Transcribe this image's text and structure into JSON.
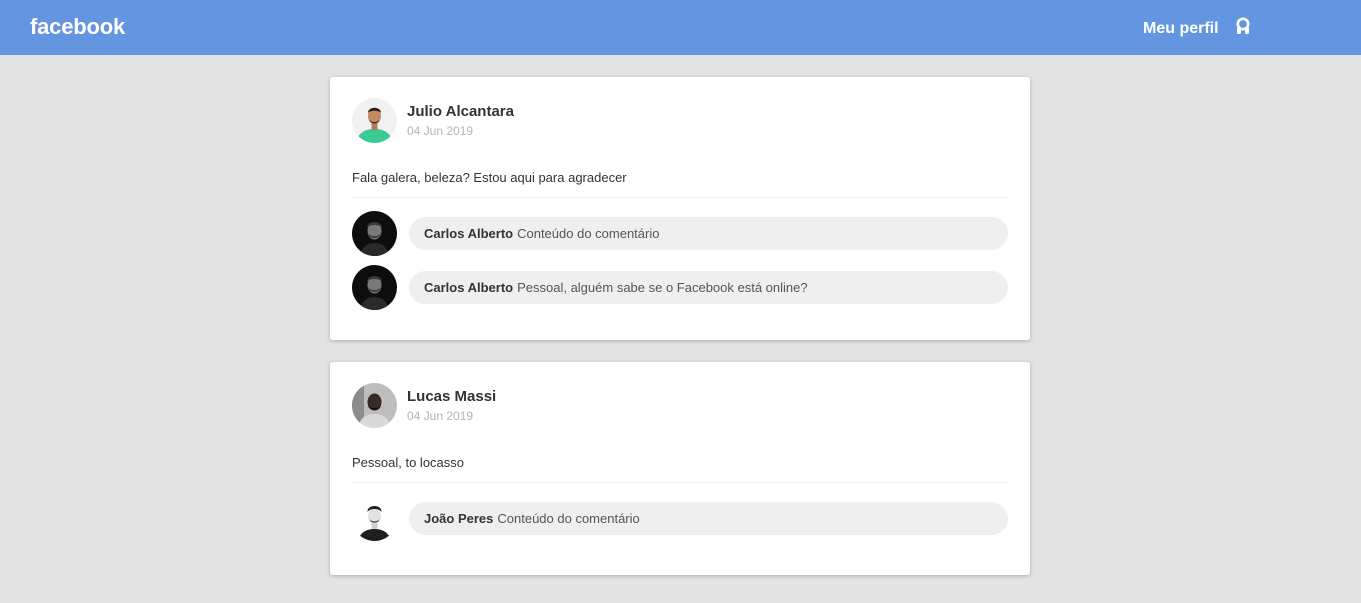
{
  "header": {
    "logo": "facebook",
    "profile_label": "Meu perfil",
    "profile_icon": "user-icon",
    "bg_color": "#6395e0"
  },
  "posts": [
    {
      "author": "Julio Alcantara",
      "date": "04 Jun 2019",
      "content": "Fala galera, beleza? Estou aqui para agradecer",
      "comments": [
        {
          "author": "Carlos Alberto",
          "text": "Conteúdo do comentário"
        },
        {
          "author": "Carlos Alberto",
          "text": "Pessoal, alguém sabe se o Facebook está online?"
        }
      ]
    },
    {
      "author": "Lucas Massi",
      "date": "04 Jun 2019",
      "content": "Pessoal, to locasso",
      "comments": [
        {
          "author": "João Peres",
          "text": "Conteúdo do comentário"
        }
      ]
    }
  ]
}
